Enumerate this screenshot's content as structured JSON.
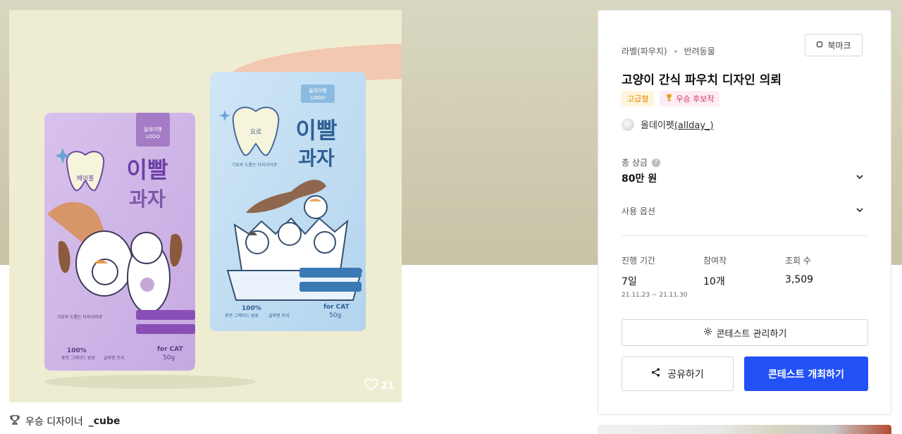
{
  "artwork": {
    "like_count": "21",
    "purple_pouch": {
      "logo": "올데이펫\nLOGO",
      "mascot": "헤어볼",
      "title_1": "이빨",
      "title_2": "과자",
      "desc": "기호와 도톰는 다리사이로\n치아를 굳어 툴라그 형성\n억제를 도와줘요~",
      "bottom_1": "100%",
      "bottom_1_sub": "휴먼 그레이드 원료",
      "bottom_2": "글루텐 프리",
      "for_cat": "for CAT",
      "weight": "50g"
    },
    "blue_pouch": {
      "logo": "올데이펫\nLOGO",
      "mascot": "요로",
      "title_1": "이빨",
      "title_2": "과자",
      "desc": "기호와 도톰는 다리사이로\n치아를 굳어 툴라그 형성\n억제를 도와줘요~",
      "bottom_1": "100%",
      "bottom_1_sub": "휴먼 그레이드 원료",
      "bottom_2": "글루텐 프리",
      "for_cat": "for CAT",
      "weight": "50g"
    }
  },
  "winner": {
    "prefix": "우승 디자이너",
    "name": "_cube"
  },
  "card": {
    "category": "라벨(파우치)",
    "subcategory": "반려동물",
    "bookmark_label": "북마크",
    "title": "고양이 간식 파우치 디자인 의뢰",
    "badges": {
      "premium": "고급형",
      "award": "우승 후보작"
    },
    "host_name": "올데이펫",
    "host_handle": "(allday_)",
    "prize_label": "총 상금",
    "prize_value": "80만 원",
    "usage_label": "사용 옵션",
    "stats": {
      "period_label": "진행 기간",
      "period_value": "7일",
      "period_range": "21.11.23 ~ 21.11.30",
      "entries_label": "참여작",
      "entries_value": "10개",
      "views_label": "조회 수",
      "views_value": "3,509"
    },
    "manage_label": "콘테스트 관리하기",
    "share_label": "공유하기",
    "host_contest_label": "콘테스트 개최하기",
    "colors": {
      "primary": "#2251f5",
      "premium": "#e08a00",
      "award": "#d6336c"
    }
  }
}
